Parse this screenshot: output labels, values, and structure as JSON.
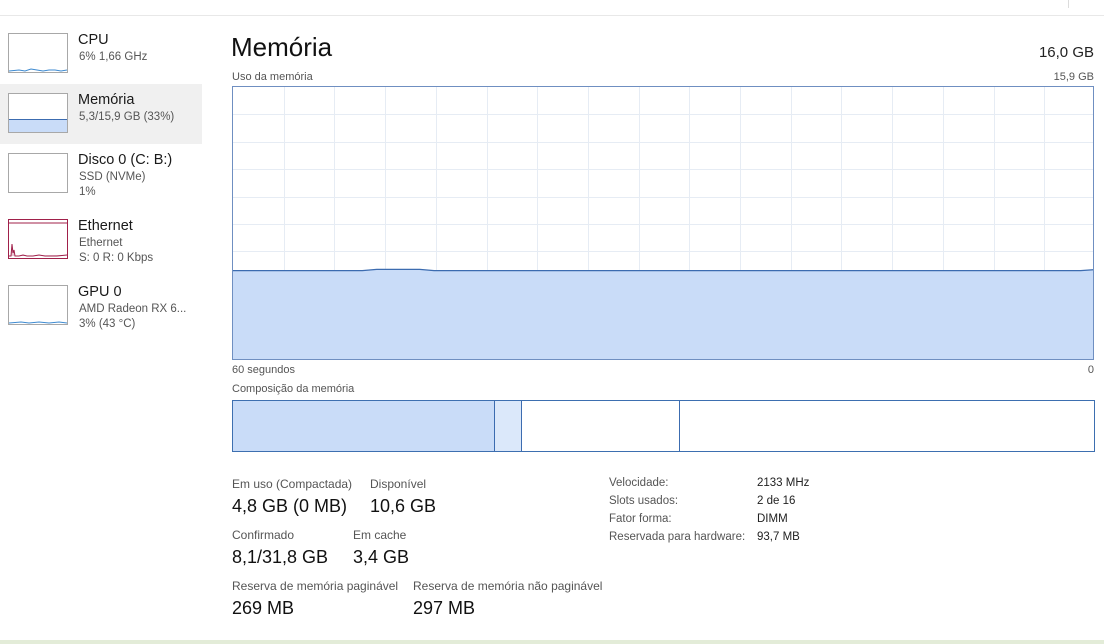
{
  "sidebar": {
    "items": [
      {
        "name": "CPU",
        "lines": [
          "6%  1,66 GHz"
        ],
        "selected": false
      },
      {
        "name": "Memória",
        "lines": [
          "5,3/15,9 GB (33%)"
        ],
        "selected": true
      },
      {
        "name": "Disco 0 (C: B:)",
        "lines": [
          "SSD (NVMe)",
          "1%"
        ],
        "selected": false
      },
      {
        "name": "Ethernet",
        "lines": [
          "Ethernet",
          "S: 0 R: 0 Kbps"
        ],
        "selected": false
      },
      {
        "name": "GPU 0",
        "lines": [
          "AMD Radeon RX 6...",
          "3%  (43 °C)"
        ],
        "selected": false
      }
    ]
  },
  "main": {
    "title": "Memória",
    "total": "16,0 GB",
    "usage_label": "Uso da memória",
    "usage_max": "15,9 GB",
    "time_left": "60 segundos",
    "time_right": "0",
    "composition_label": "Composição da memória",
    "usage_fraction": 0.33
  },
  "stats": {
    "in_use_label": "Em uso (Compactada)",
    "in_use_value": "4,8 GB (0 MB)",
    "available_label": "Disponível",
    "available_value": "10,6 GB",
    "committed_label": "Confirmado",
    "committed_value": "8,1/31,8 GB",
    "cached_label": "Em cache",
    "cached_value": "3,4 GB",
    "paged_label": "Reserva de memória paginável",
    "paged_value": "269 MB",
    "nonpaged_label": "Reserva de memória não paginável",
    "nonpaged_value": "297 MB"
  },
  "details": [
    {
      "label": "Velocidade:",
      "value": "2133 MHz"
    },
    {
      "label": "Slots usados:",
      "value": "2 de 16"
    },
    {
      "label": "Fator forma:",
      "value": "DIMM"
    },
    {
      "label": "Reservada para hardware:",
      "value": "93,7 MB"
    }
  ],
  "colors": {
    "memory_fill": "#c9dcf8",
    "memory_line": "#3c6cb0",
    "ethernet": "#a0204a",
    "cpu": "#3e8ad0",
    "grid": "#e6ecf4"
  }
}
